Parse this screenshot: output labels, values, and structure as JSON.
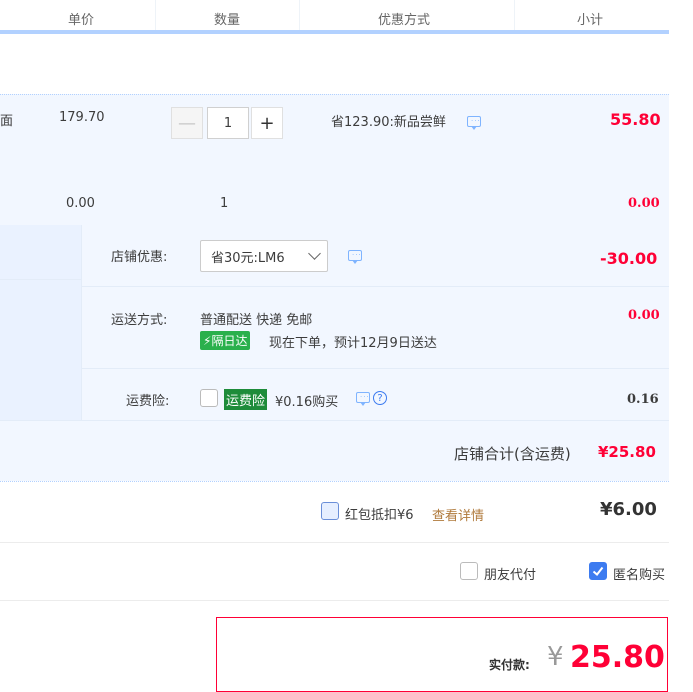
{
  "header": {
    "unit_price": "单价",
    "quantity": "数量",
    "discount_method": "优惠方式",
    "subtotal": "小计"
  },
  "item": {
    "name_fragment": "面",
    "unit_price": "179.70",
    "quantity": "1",
    "discount": "省123.90:新品尝鲜",
    "subtotal": "55.80",
    "minus_symbol": "—",
    "plus_symbol": "+"
  },
  "sub_item": {
    "unit_price": "0.00",
    "quantity": "1",
    "subtotal": "0.00"
  },
  "shop_discount": {
    "label": "店铺优惠:",
    "selected": "省30元:LM6",
    "amount": "-30.00"
  },
  "shipping": {
    "label": "运送方式:",
    "method": "普通配送 快递 免邮",
    "badge": "隔日达",
    "badge_icon": "⚡",
    "eta": "现在下单，预计12月9日送达",
    "amount": "0.00"
  },
  "insurance": {
    "label": "运费险:",
    "badge": "运费险",
    "price": "¥0.16购买",
    "help": "?",
    "amount": "0.16"
  },
  "shop_total": {
    "label": "店铺合计(含运费)",
    "amount": "¥25.80"
  },
  "red_packet": {
    "label": "红包抵扣¥6",
    "details_link": "查看详情",
    "amount": "¥6.00"
  },
  "options": {
    "friend_pay": "朋友代付",
    "anonymous": "匿名购买"
  },
  "payment": {
    "label": "实付款:",
    "currency": "¥",
    "amount": "25.80"
  },
  "colors": {
    "accent_red": "#ff0036",
    "accent_blue": "#3c7bf0",
    "row_bg": "#f2f7ff"
  }
}
